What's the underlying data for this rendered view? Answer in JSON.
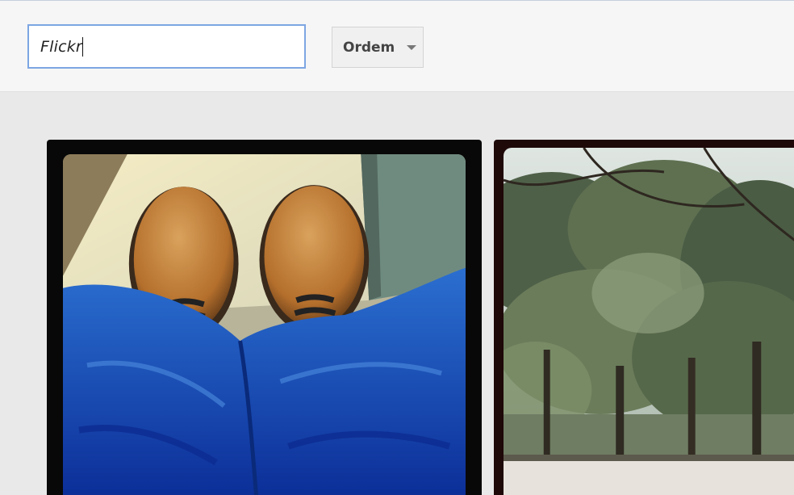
{
  "search": {
    "value": "Flickr"
  },
  "order": {
    "label": "Ordem"
  },
  "photos": [
    {
      "subject": "shoes-and-jeans"
    },
    {
      "subject": "forest-trees"
    }
  ],
  "colors": {
    "search_border": "#7da6e3",
    "photo_frame_1": "#080808",
    "photo_frame_2": "#1e0808"
  }
}
